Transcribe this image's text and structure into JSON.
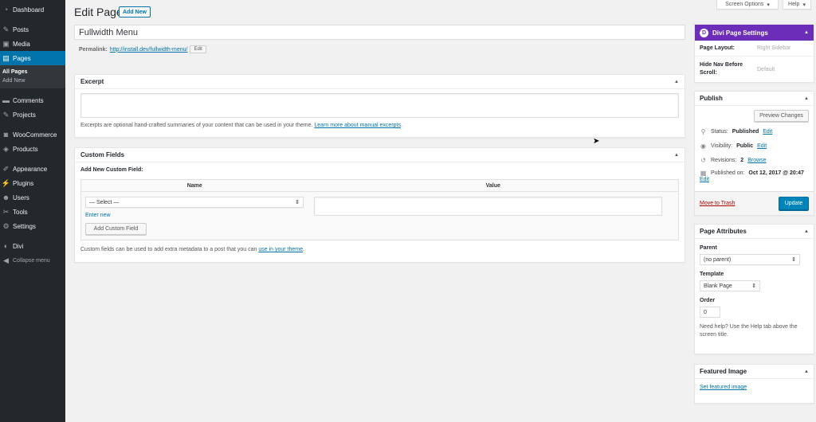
{
  "sidebar": {
    "items": [
      {
        "label": "Dashboard",
        "icon": "dashboard-icon"
      },
      {
        "label": "Posts",
        "icon": "pin-icon"
      },
      {
        "label": "Media",
        "icon": "media-icon"
      },
      {
        "label": "Pages",
        "icon": "pages-icon"
      }
    ],
    "submenu": [
      "All Pages",
      "Add New"
    ],
    "items2": [
      {
        "label": "Comments",
        "icon": "comment-icon"
      },
      {
        "label": "Projects",
        "icon": "pin-icon"
      }
    ],
    "items3": [
      {
        "label": "WooCommerce",
        "icon": "woocommerce-icon"
      },
      {
        "label": "Products",
        "icon": "products-icon"
      }
    ],
    "items4": [
      {
        "label": "Appearance",
        "icon": "brush-icon"
      },
      {
        "label": "Plugins",
        "icon": "plug-icon"
      },
      {
        "label": "Users",
        "icon": "users-icon"
      },
      {
        "label": "Tools",
        "icon": "wrench-icon"
      },
      {
        "label": "Settings",
        "icon": "settings-icon"
      }
    ],
    "items5": [
      {
        "label": "Divi",
        "icon": "divi-icon"
      },
      {
        "label": "Collapse menu",
        "icon": "collapse-icon"
      }
    ]
  },
  "screen_meta": {
    "screen_options": "Screen Options",
    "help": "Help"
  },
  "header": {
    "title": "Edit Page",
    "add_new": "Add New"
  },
  "post": {
    "title": "Fullwidth Menu",
    "permalink_label": "Permalink:",
    "permalink_url": "http://install.dev/fullwidth-menu/",
    "edit_label": "Edit"
  },
  "excerpt": {
    "title": "Excerpt",
    "help_text": "Excerpts are optional hand-crafted summaries of your content that can be used in your theme.",
    "help_link": "Learn more about manual excerpts",
    "help_end": "."
  },
  "custom_fields": {
    "title": "Custom Fields",
    "add_new_label": "Add New Custom Field:",
    "col_name": "Name",
    "col_value": "Value",
    "select_value": "— Select —",
    "enter_new": "Enter new",
    "add_button": "Add Custom Field",
    "help_text": "Custom fields can be used to add extra metadata to a post that you can",
    "help_link": "use in your theme",
    "help_end": "."
  },
  "divi": {
    "title": "Divi Page Settings",
    "logo_letter": "D",
    "layout_label": "Page Layout:",
    "layout_value": "Right Sidebar",
    "hidenav_label": "Hide Nav Before Scroll:",
    "hidenav_value": "Default",
    "accent": "#6c2eb9"
  },
  "publish": {
    "title": "Publish",
    "preview": "Preview Changes",
    "status_label": "Status:",
    "status_value": "Published",
    "visibility_label": "Visibility:",
    "visibility_value": "Public",
    "revisions_label": "Revisions:",
    "revisions_value": "2",
    "browse": "Browse",
    "published_label": "Published on:",
    "published_value": "Oct 12, 2017 @ 20:47",
    "edit": "Edit",
    "trash": "Move to Trash",
    "update": "Update"
  },
  "page_attributes": {
    "title": "Page Attributes",
    "parent_label": "Parent",
    "parent_value": "(no parent)",
    "template_label": "Template",
    "template_value": "Blank Page",
    "order_label": "Order",
    "order_value": "0",
    "help_text": "Need help? Use the Help tab above the screen title."
  },
  "featured_image": {
    "title": "Featured Image",
    "link": "Set featured image"
  },
  "colors": {
    "admin_bg": "#23282d",
    "link": "#0073aa",
    "primary_button": "#0085ba",
    "trash": "#a00"
  }
}
